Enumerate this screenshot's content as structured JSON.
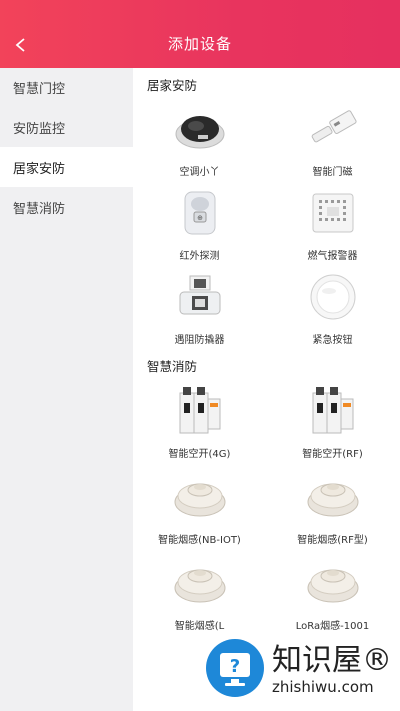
{
  "header": {
    "title": "添加设备",
    "back_label": "<"
  },
  "sidebar": {
    "items": [
      {
        "label": "智慧门控"
      },
      {
        "label": "安防监控"
      },
      {
        "label": "居家安防"
      },
      {
        "label": "智慧消防"
      }
    ],
    "active_index": 2
  },
  "sections": [
    {
      "title": "居家安防",
      "devices": [
        {
          "label": "空调小丫",
          "icon": "ac-controller-icon"
        },
        {
          "label": "智能门磁",
          "icon": "door-sensor-icon"
        },
        {
          "label": "红外探测",
          "icon": "infrared-detector-icon"
        },
        {
          "label": "燃气报警器",
          "icon": "gas-alarm-icon"
        },
        {
          "label": "遇阻防撬器",
          "icon": "anti-pry-icon"
        },
        {
          "label": "紧急按钮",
          "icon": "emergency-button-icon"
        }
      ]
    },
    {
      "title": "智慧消防",
      "devices": [
        {
          "label": "智能空开(4G)",
          "icon": "circuit-breaker-icon"
        },
        {
          "label": "智能空开(RF)",
          "icon": "circuit-breaker-icon"
        },
        {
          "label": "智能烟感(NB-IOT)",
          "icon": "smoke-detector-icon"
        },
        {
          "label": "智能烟感(RF型)",
          "icon": "smoke-detector-icon"
        },
        {
          "label": "智能烟感(L",
          "icon": "smoke-detector-icon"
        },
        {
          "label": "LoRa烟感-1001",
          "icon": "smoke-detector-icon"
        }
      ]
    }
  ],
  "watermark": {
    "main": "知识屋®",
    "sub": "zhishiwu.com"
  },
  "colors": {
    "header_start": "#f2435a",
    "header_end": "#e6305f",
    "sidebar_bg": "#f0f0f2",
    "watermark_blue": "#1e88d8"
  }
}
